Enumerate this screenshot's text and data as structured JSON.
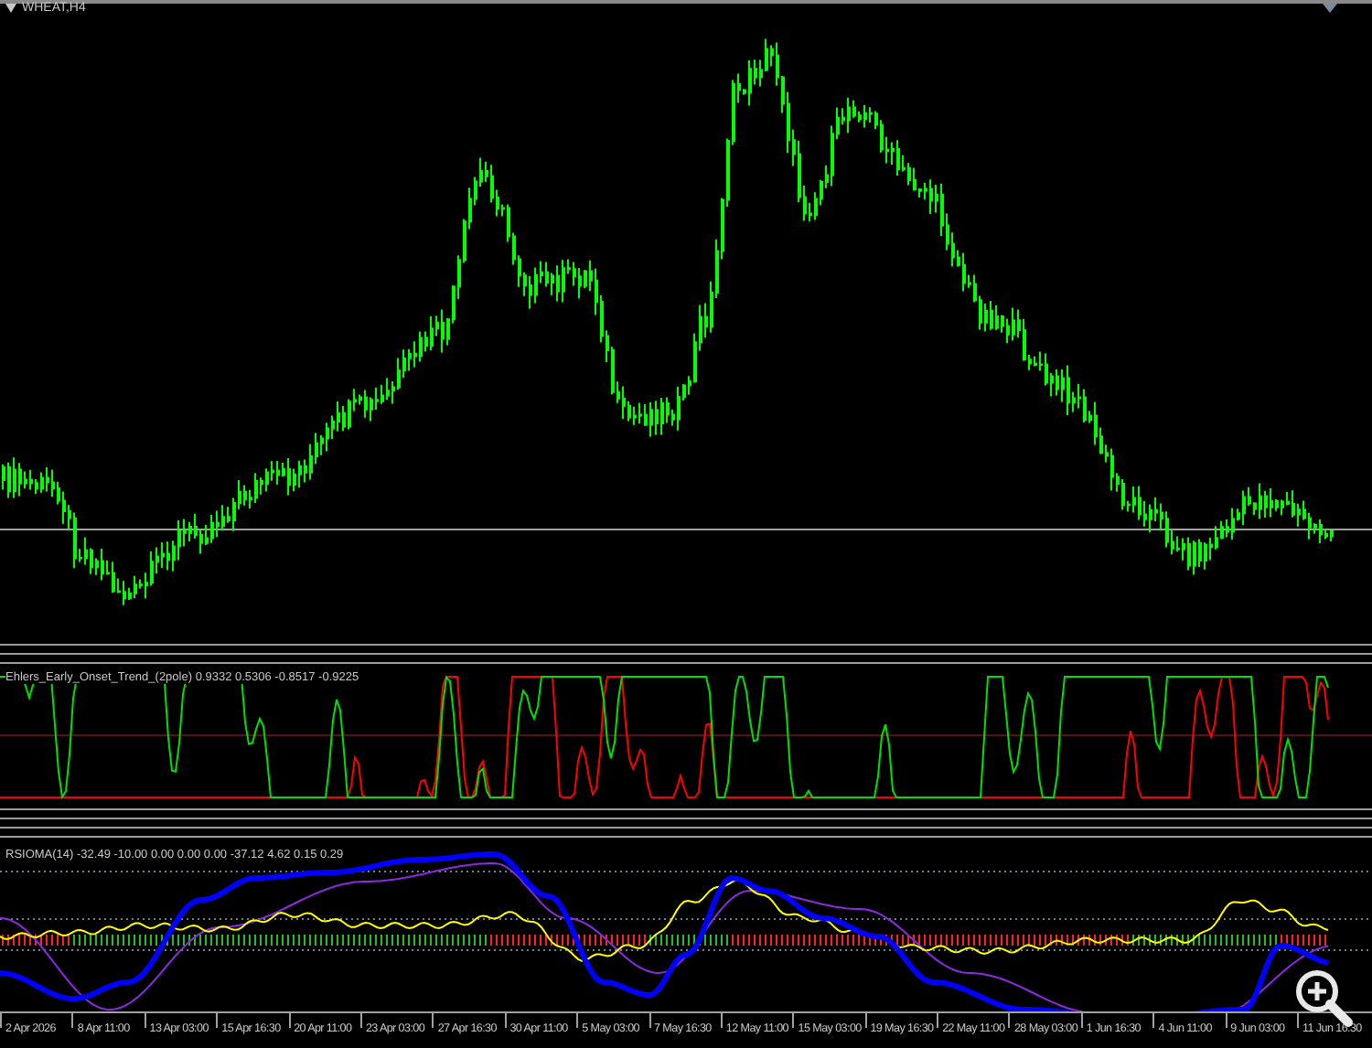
{
  "chart": {
    "symbol": "WHEAT,H4"
  },
  "indicators": [
    {
      "kind": "onset",
      "label": "Ehlers_Early_Onset_Trend_(2pole) 0.9332 0.5306 -0.8517 -0.9225"
    },
    {
      "kind": "rsioma",
      "label": "RSIOMA(14) -32.49 -10.00 0.00 0.00 0.00 -37.12 4.62 0.15 0.29"
    }
  ],
  "time_axis": [
    "2 Apr 2026",
    "8 Apr 11:00",
    "13 Apr 03:00",
    "15 Apr 16:30",
    "20 Apr 11:00",
    "23 Apr 03:00",
    "27 Apr 16:30",
    "30 Apr 11:00",
    "5 May 03:00",
    "7 May 16:30",
    "12 May 11:00",
    "15 May 03:00",
    "19 May 16:30",
    "22 May 11:00",
    "28 May 03:00",
    "1 Jun 16:30",
    "4 Jun 11:00",
    "9 Jun 03:00",
    "11 Jun 16:30"
  ]
}
